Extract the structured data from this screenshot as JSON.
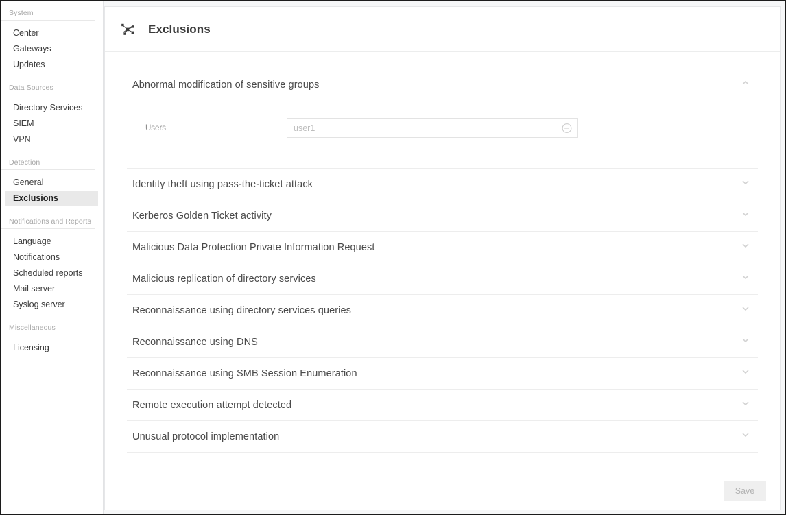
{
  "sidebar": {
    "sections": [
      {
        "label": "System",
        "items": [
          {
            "label": "Center",
            "selected": false
          },
          {
            "label": "Gateways",
            "selected": false
          },
          {
            "label": "Updates",
            "selected": false
          }
        ]
      },
      {
        "label": "Data Sources",
        "items": [
          {
            "label": "Directory Services",
            "selected": false
          },
          {
            "label": "SIEM",
            "selected": false
          },
          {
            "label": "VPN",
            "selected": false
          }
        ]
      },
      {
        "label": "Detection",
        "items": [
          {
            "label": "General",
            "selected": false
          },
          {
            "label": "Exclusions",
            "selected": true
          }
        ]
      },
      {
        "label": "Notifications and Reports",
        "items": [
          {
            "label": "Language",
            "selected": false
          },
          {
            "label": "Notifications",
            "selected": false
          },
          {
            "label": "Scheduled reports",
            "selected": false
          },
          {
            "label": "Mail server",
            "selected": false
          },
          {
            "label": "Syslog server",
            "selected": false
          }
        ]
      },
      {
        "label": "Miscellaneous",
        "items": [
          {
            "label": "Licensing",
            "selected": false
          }
        ]
      }
    ]
  },
  "header": {
    "title": "Exclusions",
    "icon": "network-nodes-icon"
  },
  "exclusions": [
    {
      "title": "Abnormal modification of sensitive groups",
      "expanded": true,
      "chevron": "chevron-up-icon",
      "field": {
        "label": "Users",
        "value": "",
        "placeholder": "user1",
        "add_icon": "circle-plus-icon"
      }
    },
    {
      "title": "Identity theft using pass-the-ticket attack",
      "expanded": false,
      "chevron": "chevron-down-icon"
    },
    {
      "title": "Kerberos Golden Ticket activity",
      "expanded": false,
      "chevron": "chevron-down-icon"
    },
    {
      "title": "Malicious Data Protection Private Information Request",
      "expanded": false,
      "chevron": "chevron-down-icon"
    },
    {
      "title": "Malicious replication of directory services",
      "expanded": false,
      "chevron": "chevron-down-icon"
    },
    {
      "title": "Reconnaissance using directory services queries",
      "expanded": false,
      "chevron": "chevron-down-icon"
    },
    {
      "title": "Reconnaissance using DNS",
      "expanded": false,
      "chevron": "chevron-down-icon"
    },
    {
      "title": "Reconnaissance using SMB Session Enumeration",
      "expanded": false,
      "chevron": "chevron-down-icon"
    },
    {
      "title": "Remote execution attempt detected",
      "expanded": false,
      "chevron": "chevron-down-icon"
    },
    {
      "title": "Unusual protocol implementation",
      "expanded": false,
      "chevron": "chevron-down-icon"
    }
  ],
  "footer": {
    "save_label": "Save",
    "save_enabled": false
  },
  "colors": {
    "page_background": "#f6f7f8",
    "card_background": "#ffffff",
    "selected_item": "#e9e9e9",
    "divider": "#ededed",
    "muted_text": "#a6a6a6"
  }
}
